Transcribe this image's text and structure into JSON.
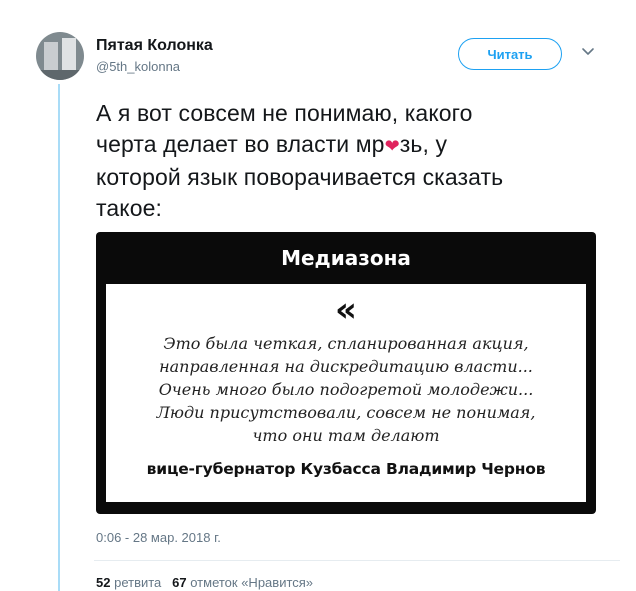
{
  "author": {
    "name": "Пятая Колонка",
    "handle": "@5th_kolonna"
  },
  "follow_button": {
    "label": "Читать"
  },
  "tweet": {
    "lines": [
      "А я вот совсем не понимаю, какого",
      "черта делает во власти мр",
      "зь, у",
      "которой язык поворачивается сказать",
      "такое:"
    ],
    "emoji": "❤"
  },
  "media": {
    "brand": "Медиазона",
    "quote_mark": "«",
    "quote_lines": [
      "Это была четкая, спланированная акция,",
      "направленная на дискредитацию власти...",
      "Очень много было подогретой молодежи...",
      "Люди присутствовали, совсем не понимая,",
      "что они там делают"
    ],
    "quote_author": "вице-губернатор Кузбасса Владимир Чернов"
  },
  "timestamp": "0:06 - 28 мар. 2018 г.",
  "stats": {
    "retweets_count": "52",
    "retweets_label": "ретвита",
    "likes_count": "67",
    "likes_label": "отметок «Нравится»"
  },
  "icons": {
    "more": "chevron-down-icon"
  }
}
